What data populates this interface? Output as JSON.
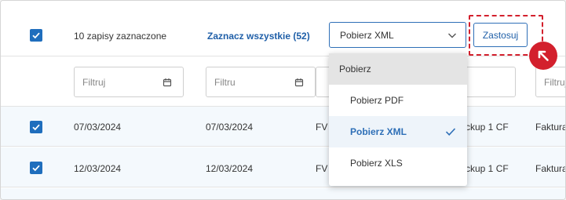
{
  "toolbar": {
    "selected_count_text": "10 zapisy zaznaczone",
    "select_all_link": "Zaznacz wszystkie (52)",
    "action_select_value": "Pobierz XML",
    "apply_button": "Zastosuj"
  },
  "filters": {
    "placeholder": "Filtruj",
    "placeholder_short": "Filtru"
  },
  "dropdown": {
    "header": "Pobierz",
    "options": [
      "Pobierz PDF",
      "Pobierz XML",
      "Pobierz XLS"
    ],
    "selected": "Pobierz XML"
  },
  "rows": [
    {
      "date1": "07/03/2024",
      "date2": "07/03/2024",
      "col3": "FV",
      "col4": "ckup 1 CF",
      "col5": "Faktura"
    },
    {
      "date1": "12/03/2024",
      "date2": "12/03/2024",
      "col3": "FV",
      "col4": "ckup 1 CF",
      "col5": "Faktura"
    }
  ],
  "colors": {
    "accent": "#1f6ebd",
    "highlight": "#d3202d",
    "row_bg": "#f4f9fd"
  }
}
